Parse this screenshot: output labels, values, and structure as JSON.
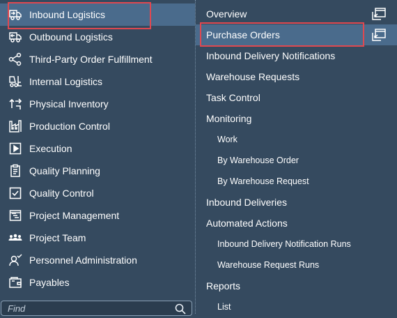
{
  "left_menu": {
    "items": [
      {
        "label": "Inbound Logistics",
        "icon": "truck-inbound-icon"
      },
      {
        "label": "Outbound Logistics",
        "icon": "truck-outbound-icon"
      },
      {
        "label": "Third-Party Order Fulfillment",
        "icon": "share-network-icon"
      },
      {
        "label": "Internal Logistics",
        "icon": "forklift-icon"
      },
      {
        "label": "Physical Inventory",
        "icon": "arrows-transfer-icon"
      },
      {
        "label": "Production Control",
        "icon": "factory-icon"
      },
      {
        "label": "Execution",
        "icon": "play-icon"
      },
      {
        "label": "Quality Planning",
        "icon": "clipboard-icon"
      },
      {
        "label": "Quality Control",
        "icon": "checkbox-icon"
      },
      {
        "label": "Project Management",
        "icon": "project-icon"
      },
      {
        "label": "Project Team",
        "icon": "team-icon"
      },
      {
        "label": "Personnel Administration",
        "icon": "person-check-icon"
      },
      {
        "label": "Payables",
        "icon": "wallet-icon"
      }
    ],
    "selected": "Inbound Logistics"
  },
  "search": {
    "placeholder": "Find"
  },
  "right_menu": {
    "items": [
      {
        "label": "Overview",
        "level": 1
      },
      {
        "label": "Purchase Orders",
        "level": 1
      },
      {
        "label": "Inbound Delivery Notifications",
        "level": 1
      },
      {
        "label": "Warehouse Requests",
        "level": 1
      },
      {
        "label": "Task Control",
        "level": 1
      },
      {
        "label": "Monitoring",
        "level": 1
      },
      {
        "label": "Work",
        "level": 2
      },
      {
        "label": "By Warehouse Order",
        "level": 2
      },
      {
        "label": "By Warehouse Request",
        "level": 2
      },
      {
        "label": "Inbound Deliveries",
        "level": 1
      },
      {
        "label": "Automated Actions",
        "level": 1
      },
      {
        "label": "Inbound Delivery Notification Runs",
        "level": 2
      },
      {
        "label": "Warehouse Request Runs",
        "level": 2
      },
      {
        "label": "Reports",
        "level": 1
      },
      {
        "label": "List",
        "level": 2
      }
    ],
    "selected": "Purchase Orders",
    "action_icon": "open-in-new-window-icon"
  },
  "colors": {
    "background": "#354a5f",
    "selected_background": "#4a6b8c",
    "highlight_border": "#e04850",
    "text": "#ffffff"
  }
}
